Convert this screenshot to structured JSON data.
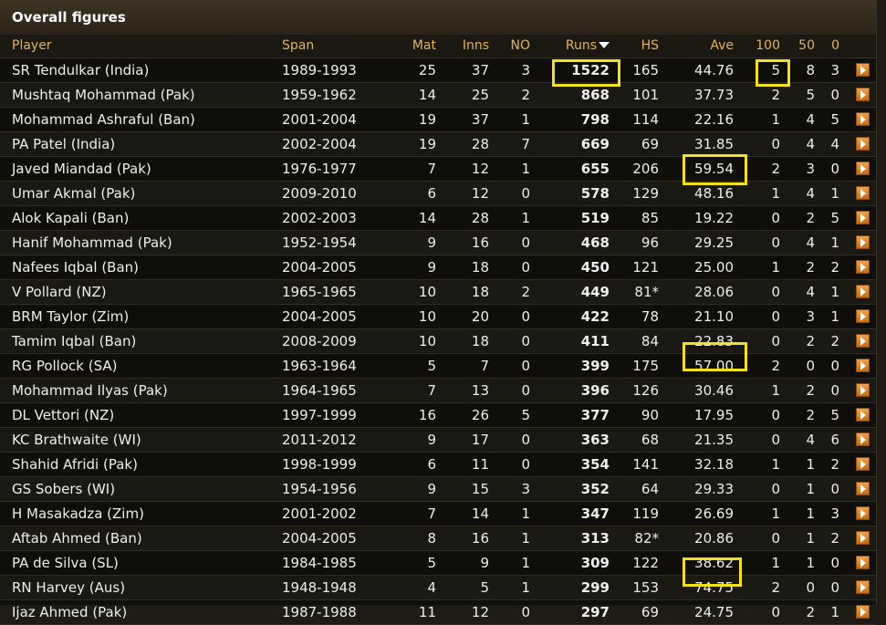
{
  "title": "Overall figures",
  "columns": {
    "player": "Player",
    "span": "Span",
    "mat": "Mat",
    "inns": "Inns",
    "no": "NO",
    "runs": "Runs",
    "hs": "HS",
    "ave": "Ave",
    "hundreds": "100",
    "fifties": "50",
    "ducks": "0"
  },
  "rows": [
    {
      "player": "SR Tendulkar (India)",
      "span": "1989-1993",
      "mat": "25",
      "inns": "37",
      "no": "3",
      "runs": "1522",
      "hs": "165",
      "ave": "44.76",
      "hundreds": "5",
      "fifties": "8",
      "ducks": "3"
    },
    {
      "player": "Mushtaq Mohammad (Pak)",
      "span": "1959-1962",
      "mat": "14",
      "inns": "25",
      "no": "2",
      "runs": "868",
      "hs": "101",
      "ave": "37.73",
      "hundreds": "2",
      "fifties": "5",
      "ducks": "0"
    },
    {
      "player": "Mohammad Ashraful (Ban)",
      "span": "2001-2004",
      "mat": "19",
      "inns": "37",
      "no": "1",
      "runs": "798",
      "hs": "114",
      "ave": "22.16",
      "hundreds": "1",
      "fifties": "4",
      "ducks": "5"
    },
    {
      "player": "PA Patel (India)",
      "span": "2002-2004",
      "mat": "19",
      "inns": "28",
      "no": "7",
      "runs": "669",
      "hs": "69",
      "ave": "31.85",
      "hundreds": "0",
      "fifties": "4",
      "ducks": "4"
    },
    {
      "player": "Javed Miandad (Pak)",
      "span": "1976-1977",
      "mat": "7",
      "inns": "12",
      "no": "1",
      "runs": "655",
      "hs": "206",
      "ave": "59.54",
      "hundreds": "2",
      "fifties": "3",
      "ducks": "0"
    },
    {
      "player": "Umar Akmal (Pak)",
      "span": "2009-2010",
      "mat": "6",
      "inns": "12",
      "no": "0",
      "runs": "578",
      "hs": "129",
      "ave": "48.16",
      "hundreds": "1",
      "fifties": "4",
      "ducks": "1"
    },
    {
      "player": "Alok Kapali (Ban)",
      "span": "2002-2003",
      "mat": "14",
      "inns": "28",
      "no": "1",
      "runs": "519",
      "hs": "85",
      "ave": "19.22",
      "hundreds": "0",
      "fifties": "2",
      "ducks": "5"
    },
    {
      "player": "Hanif Mohammad (Pak)",
      "span": "1952-1954",
      "mat": "9",
      "inns": "16",
      "no": "0",
      "runs": "468",
      "hs": "96",
      "ave": "29.25",
      "hundreds": "0",
      "fifties": "4",
      "ducks": "1"
    },
    {
      "player": "Nafees Iqbal (Ban)",
      "span": "2004-2005",
      "mat": "9",
      "inns": "18",
      "no": "0",
      "runs": "450",
      "hs": "121",
      "ave": "25.00",
      "hundreds": "1",
      "fifties": "2",
      "ducks": "2"
    },
    {
      "player": "V Pollard (NZ)",
      "span": "1965-1965",
      "mat": "10",
      "inns": "18",
      "no": "2",
      "runs": "449",
      "hs": "81*",
      "ave": "28.06",
      "hundreds": "0",
      "fifties": "4",
      "ducks": "1"
    },
    {
      "player": "BRM Taylor (Zim)",
      "span": "2004-2005",
      "mat": "10",
      "inns": "20",
      "no": "0",
      "runs": "422",
      "hs": "78",
      "ave": "21.10",
      "hundreds": "0",
      "fifties": "3",
      "ducks": "1"
    },
    {
      "player": "Tamim Iqbal (Ban)",
      "span": "2008-2009",
      "mat": "10",
      "inns": "18",
      "no": "0",
      "runs": "411",
      "hs": "84",
      "ave": "22.83",
      "hundreds": "0",
      "fifties": "2",
      "ducks": "2"
    },
    {
      "player": "RG Pollock (SA)",
      "span": "1963-1964",
      "mat": "5",
      "inns": "7",
      "no": "0",
      "runs": "399",
      "hs": "175",
      "ave": "57.00",
      "hundreds": "2",
      "fifties": "0",
      "ducks": "0"
    },
    {
      "player": "Mohammad Ilyas (Pak)",
      "span": "1964-1965",
      "mat": "7",
      "inns": "13",
      "no": "0",
      "runs": "396",
      "hs": "126",
      "ave": "30.46",
      "hundreds": "1",
      "fifties": "2",
      "ducks": "0"
    },
    {
      "player": "DL Vettori (NZ)",
      "span": "1997-1999",
      "mat": "16",
      "inns": "26",
      "no": "5",
      "runs": "377",
      "hs": "90",
      "ave": "17.95",
      "hundreds": "0",
      "fifties": "2",
      "ducks": "5"
    },
    {
      "player": "KC Brathwaite (WI)",
      "span": "2011-2012",
      "mat": "9",
      "inns": "17",
      "no": "0",
      "runs": "363",
      "hs": "68",
      "ave": "21.35",
      "hundreds": "0",
      "fifties": "4",
      "ducks": "6"
    },
    {
      "player": "Shahid Afridi (Pak)",
      "span": "1998-1999",
      "mat": "6",
      "inns": "11",
      "no": "0",
      "runs": "354",
      "hs": "141",
      "ave": "32.18",
      "hundreds": "1",
      "fifties": "1",
      "ducks": "2"
    },
    {
      "player": "GS Sobers (WI)",
      "span": "1954-1956",
      "mat": "9",
      "inns": "15",
      "no": "3",
      "runs": "352",
      "hs": "64",
      "ave": "29.33",
      "hundreds": "0",
      "fifties": "1",
      "ducks": "0"
    },
    {
      "player": "H Masakadza (Zim)",
      "span": "2001-2002",
      "mat": "7",
      "inns": "14",
      "no": "1",
      "runs": "347",
      "hs": "119",
      "ave": "26.69",
      "hundreds": "1",
      "fifties": "1",
      "ducks": "3"
    },
    {
      "player": "Aftab Ahmed (Ban)",
      "span": "2004-2005",
      "mat": "8",
      "inns": "16",
      "no": "1",
      "runs": "313",
      "hs": "82*",
      "ave": "20.86",
      "hundreds": "0",
      "fifties": "1",
      "ducks": "2"
    },
    {
      "player": "PA de Silva (SL)",
      "span": "1984-1985",
      "mat": "5",
      "inns": "9",
      "no": "1",
      "runs": "309",
      "hs": "122",
      "ave": "38.62",
      "hundreds": "1",
      "fifties": "1",
      "ducks": "0"
    },
    {
      "player": "RN Harvey (Aus)",
      "span": "1948-1948",
      "mat": "4",
      "inns": "5",
      "no": "1",
      "runs": "299",
      "hs": "153",
      "ave": "74.75",
      "hundreds": "2",
      "fifties": "0",
      "ducks": "0"
    },
    {
      "player": "Ijaz Ahmed (Pak)",
      "span": "1987-1988",
      "mat": "11",
      "inns": "12",
      "no": "0",
      "runs": "297",
      "hs": "69",
      "ave": "24.75",
      "hundreds": "0",
      "fifties": "2",
      "ducks": "1"
    }
  ],
  "colors": {
    "header_text": "#e2b45a",
    "highlight": "#f2e21a",
    "button": "#e08a2a"
  },
  "icons": {
    "sort": "sort-desc-icon",
    "row_action": "play-arrow-icon"
  }
}
